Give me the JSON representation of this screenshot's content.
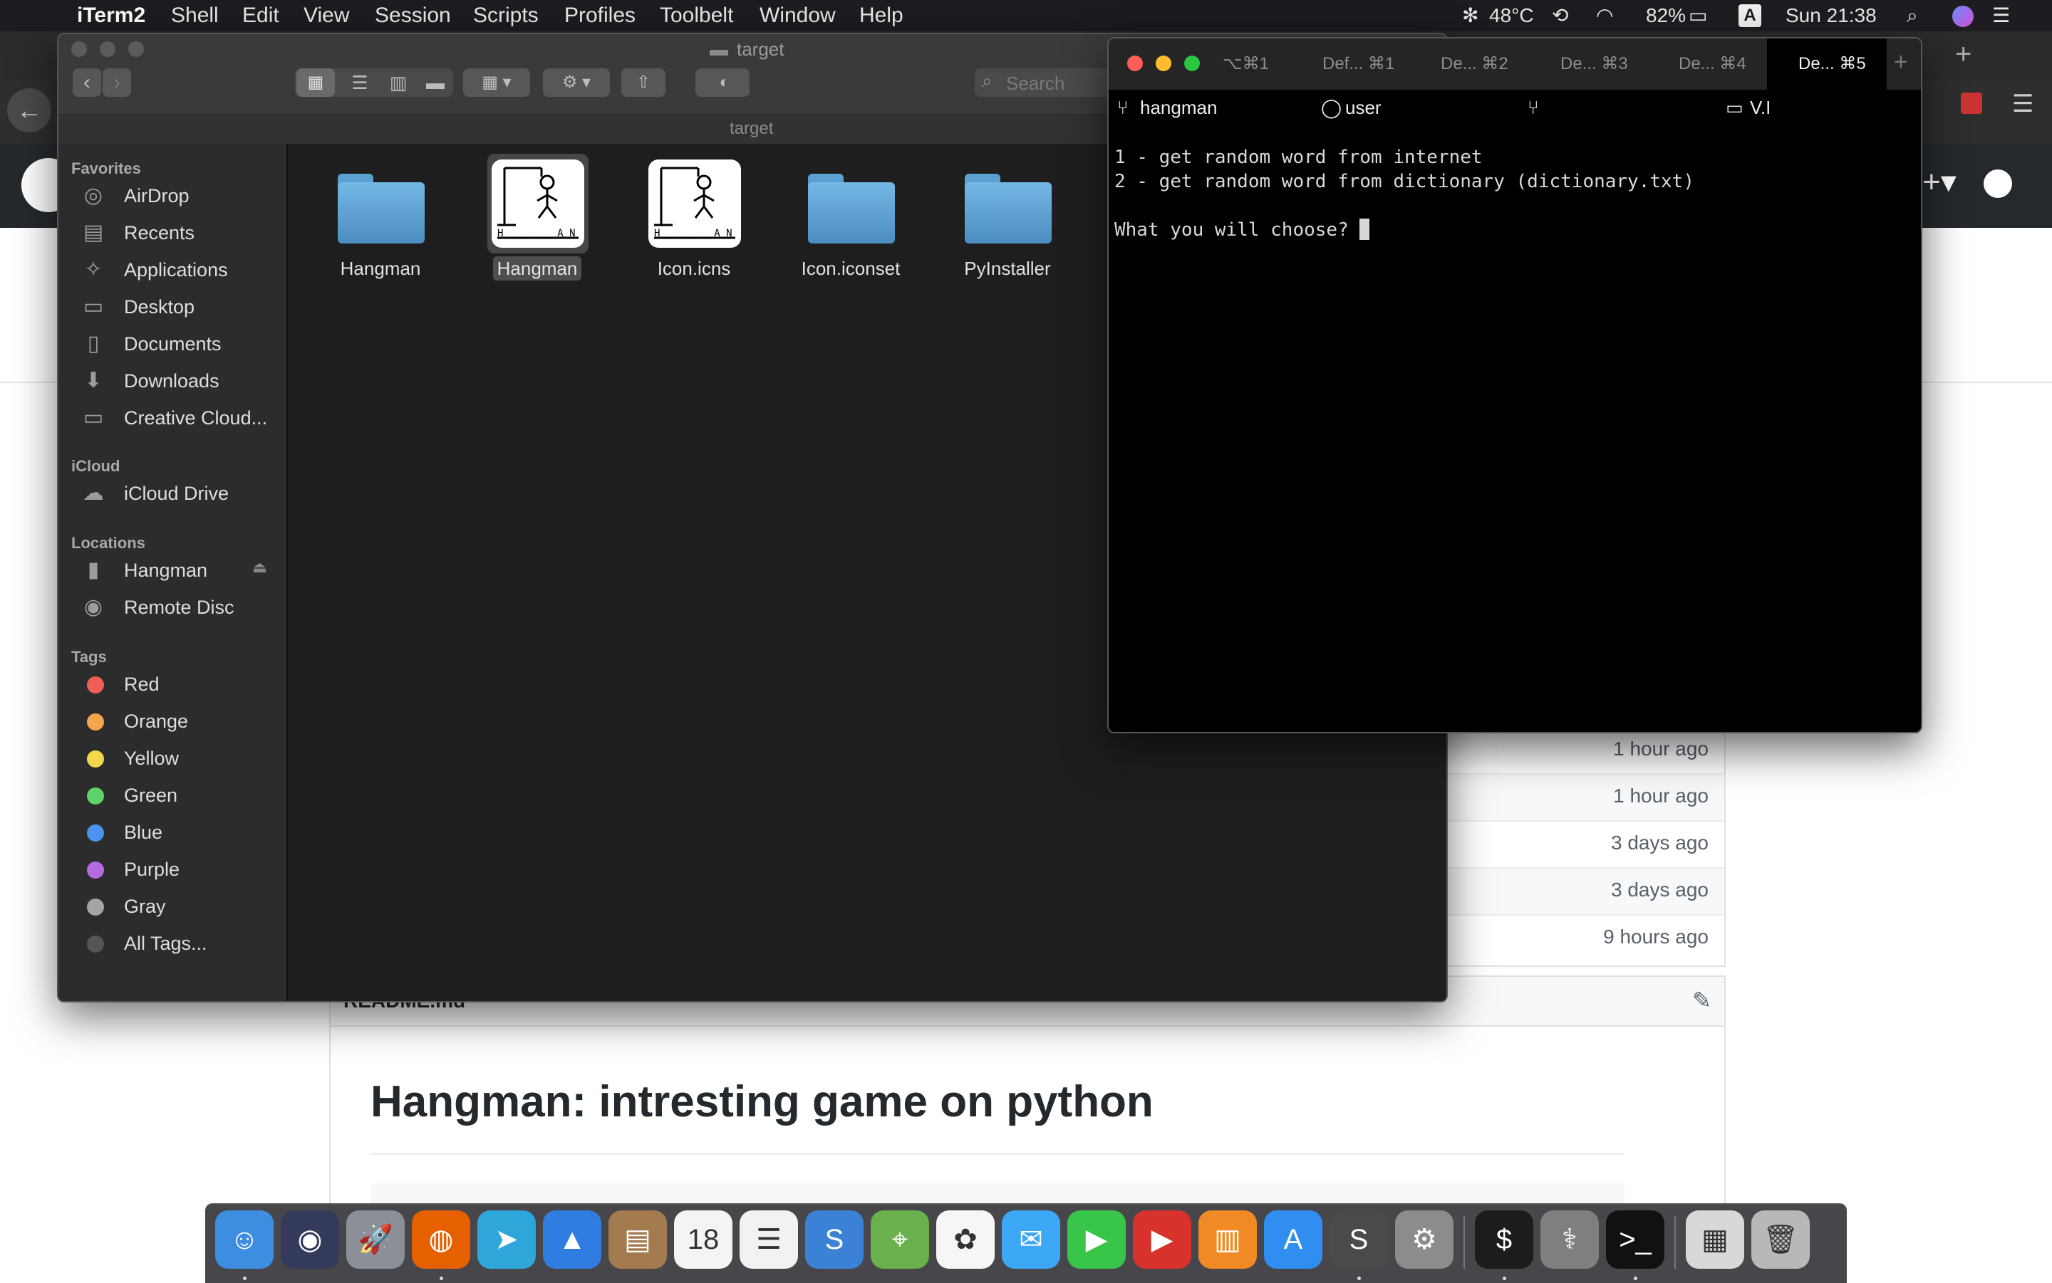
{
  "menubar": {
    "app": "iTerm2",
    "items": [
      "Shell",
      "Edit",
      "View",
      "Session",
      "Scripts",
      "Profiles",
      "Toolbelt",
      "Window",
      "Help"
    ],
    "status": {
      "temp": "48°C",
      "battery": "82%",
      "input": "A",
      "clock": "Sun 21:38"
    }
  },
  "finder": {
    "title": "target",
    "path": "target",
    "search_placeholder": "Search",
    "sidebar": {
      "favorites_title": "Favorites",
      "favorites": [
        "AirDrop",
        "Recents",
        "Applications",
        "Desktop",
        "Documents",
        "Downloads",
        "Creative Cloud..."
      ],
      "icloud_title": "iCloud",
      "icloud": [
        "iCloud Drive"
      ],
      "locations_title": "Locations",
      "locations": [
        "Hangman",
        "Remote Disc"
      ],
      "tags_title": "Tags",
      "tags": [
        {
          "label": "Red",
          "color": "#ef5f58"
        },
        {
          "label": "Orange",
          "color": "#f4a64a"
        },
        {
          "label": "Yellow",
          "color": "#f4d74a"
        },
        {
          "label": "Green",
          "color": "#5ed36a"
        },
        {
          "label": "Blue",
          "color": "#4a93f0"
        },
        {
          "label": "Purple",
          "color": "#b769e0"
        },
        {
          "label": "Gray",
          "color": "#a5a5a5"
        },
        {
          "label": "All Tags...",
          "color": "#555555"
        }
      ]
    },
    "files": [
      {
        "name": "Hangman",
        "kind": "folder",
        "selected": false
      },
      {
        "name": "Hangman",
        "kind": "app",
        "selected": true
      },
      {
        "name": "Icon.icns",
        "kind": "app",
        "selected": false
      },
      {
        "name": "Icon.iconset",
        "kind": "folder",
        "selected": false
      },
      {
        "name": "PyInstaller",
        "kind": "folder",
        "selected": false
      }
    ],
    "app_icon_caption": "H _ _ _ _ A N"
  },
  "iterm": {
    "tabs": [
      {
        "label": "⌥⌘1"
      },
      {
        "label": "Def...  ⌘1"
      },
      {
        "label": "De...  ⌘2"
      },
      {
        "label": "De...  ⌘3"
      },
      {
        "label": "De...  ⌘4"
      },
      {
        "label": "De...  ⌘5"
      }
    ],
    "status": {
      "dir": "hangman",
      "user": "user",
      "host": "V.I"
    },
    "lines": [
      "1 - get random word from internet",
      "2 - get random word from dictionary (dictionary.txt)",
      "",
      "What you will choose? "
    ]
  },
  "github": {
    "times": [
      "1 hour ago",
      "1 hour ago",
      "3 days ago",
      "3 days ago",
      "9 hours ago"
    ],
    "readme_file": "README.md",
    "readme_title": "Hangman: intresting game on python"
  },
  "dock": {
    "apps": [
      {
        "name": "finder-icon",
        "color": "#3d8de0",
        "glyph": "☺",
        "running": true
      },
      {
        "name": "siri-icon",
        "color": "#333a5a",
        "glyph": "◉",
        "running": false
      },
      {
        "name": "launchpad-icon",
        "color": "#8a8f98",
        "glyph": "🚀",
        "running": false
      },
      {
        "name": "firefox-icon",
        "color": "#e66000",
        "glyph": "◍",
        "running": true
      },
      {
        "name": "telegram-icon",
        "color": "#2ea6da",
        "glyph": "➤",
        "running": false
      },
      {
        "name": "spark-icon",
        "color": "#2f7de1",
        "glyph": "▲",
        "running": false
      },
      {
        "name": "contacts-icon",
        "color": "#a47b4f",
        "glyph": "▤",
        "running": false
      },
      {
        "name": "calendar-icon",
        "color": "#f4f4f4",
        "glyph": "18",
        "running": false
      },
      {
        "name": "reminders-icon",
        "color": "#f2f2f2",
        "glyph": "☰",
        "running": false
      },
      {
        "name": "simplenote-icon",
        "color": "#3b82d6",
        "glyph": "S",
        "running": false
      },
      {
        "name": "maps-icon",
        "color": "#6ab04c",
        "glyph": "⌖",
        "running": false
      },
      {
        "name": "photos-icon",
        "color": "#f6f6f6",
        "glyph": "✿",
        "running": false
      },
      {
        "name": "messages-icon",
        "color": "#3ba7f5",
        "glyph": "✉",
        "running": false
      },
      {
        "name": "facetime-icon",
        "color": "#39c44a",
        "glyph": "▶",
        "running": false
      },
      {
        "name": "music-player-icon",
        "color": "#d8322c",
        "glyph": "▶",
        "running": false
      },
      {
        "name": "books-icon",
        "color": "#f08a24",
        "glyph": "▥",
        "running": false
      },
      {
        "name": "app-store-icon",
        "color": "#2f8ef0",
        "glyph": "A",
        "running": false
      },
      {
        "name": "sublime-text-icon",
        "color": "#4a4a4a",
        "glyph": "S",
        "running": true
      },
      {
        "name": "system-preferences-icon",
        "color": "#8c8c8c",
        "glyph": "⚙",
        "running": false
      },
      {
        "name": "iterm-icon",
        "color": "#1c1c1c",
        "glyph": "$",
        "running": true
      },
      {
        "name": "disk-utility-icon",
        "color": "#7f7f7f",
        "glyph": "⚕",
        "running": false
      },
      {
        "name": "terminal-icon",
        "color": "#111111",
        "glyph": ">_",
        "running": true
      },
      {
        "name": "documents-icon",
        "color": "#d8d8d8",
        "glyph": "▦",
        "running": false
      },
      {
        "name": "trash-icon",
        "color": "#b8b8b8",
        "glyph": "🗑",
        "running": false
      }
    ]
  }
}
